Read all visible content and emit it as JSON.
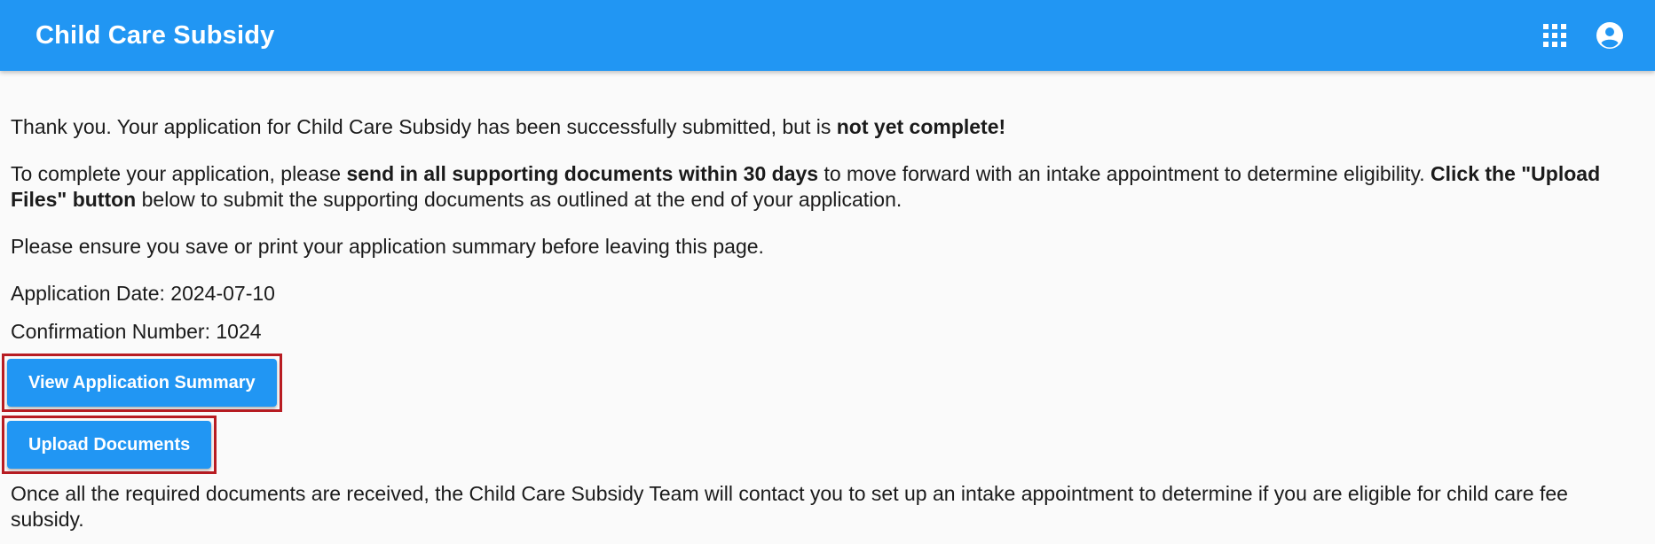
{
  "header": {
    "title": "Child Care Subsidy",
    "apps_icon": "apps-grid-icon",
    "account_icon": "account-circle-icon",
    "color": "#2196f3"
  },
  "main": {
    "para1": {
      "text": "Thank you. Your application for Child Care Subsidy has been successfully submitted, but is ",
      "bold": "not yet complete!"
    },
    "para2": {
      "part1": "To complete your application, please ",
      "bold1": "send in all supporting documents within 30 days",
      "part2": " to move forward with an intake appointment to determine eligibility. ",
      "bold2": "Click the \"Upload Files\" button",
      "part3": " below to submit the supporting documents as outlined at the end of your application."
    },
    "para3": "Please ensure you save or print your application summary before leaving this page.",
    "application_date": {
      "label": "Application Date: ",
      "value": "2024-07-10"
    },
    "confirmation_number": {
      "label": "Confirmation Number: ",
      "value": "1024"
    },
    "buttons": {
      "view_summary": "View Application Summary",
      "upload_documents": "Upload Documents"
    },
    "closing": "Once all the required documents are received, the Child Care Subsidy Team will contact you to set up an intake appointment to determine if you are eligible for child care fee subsidy.",
    "highlight_color": "#b81c22"
  }
}
